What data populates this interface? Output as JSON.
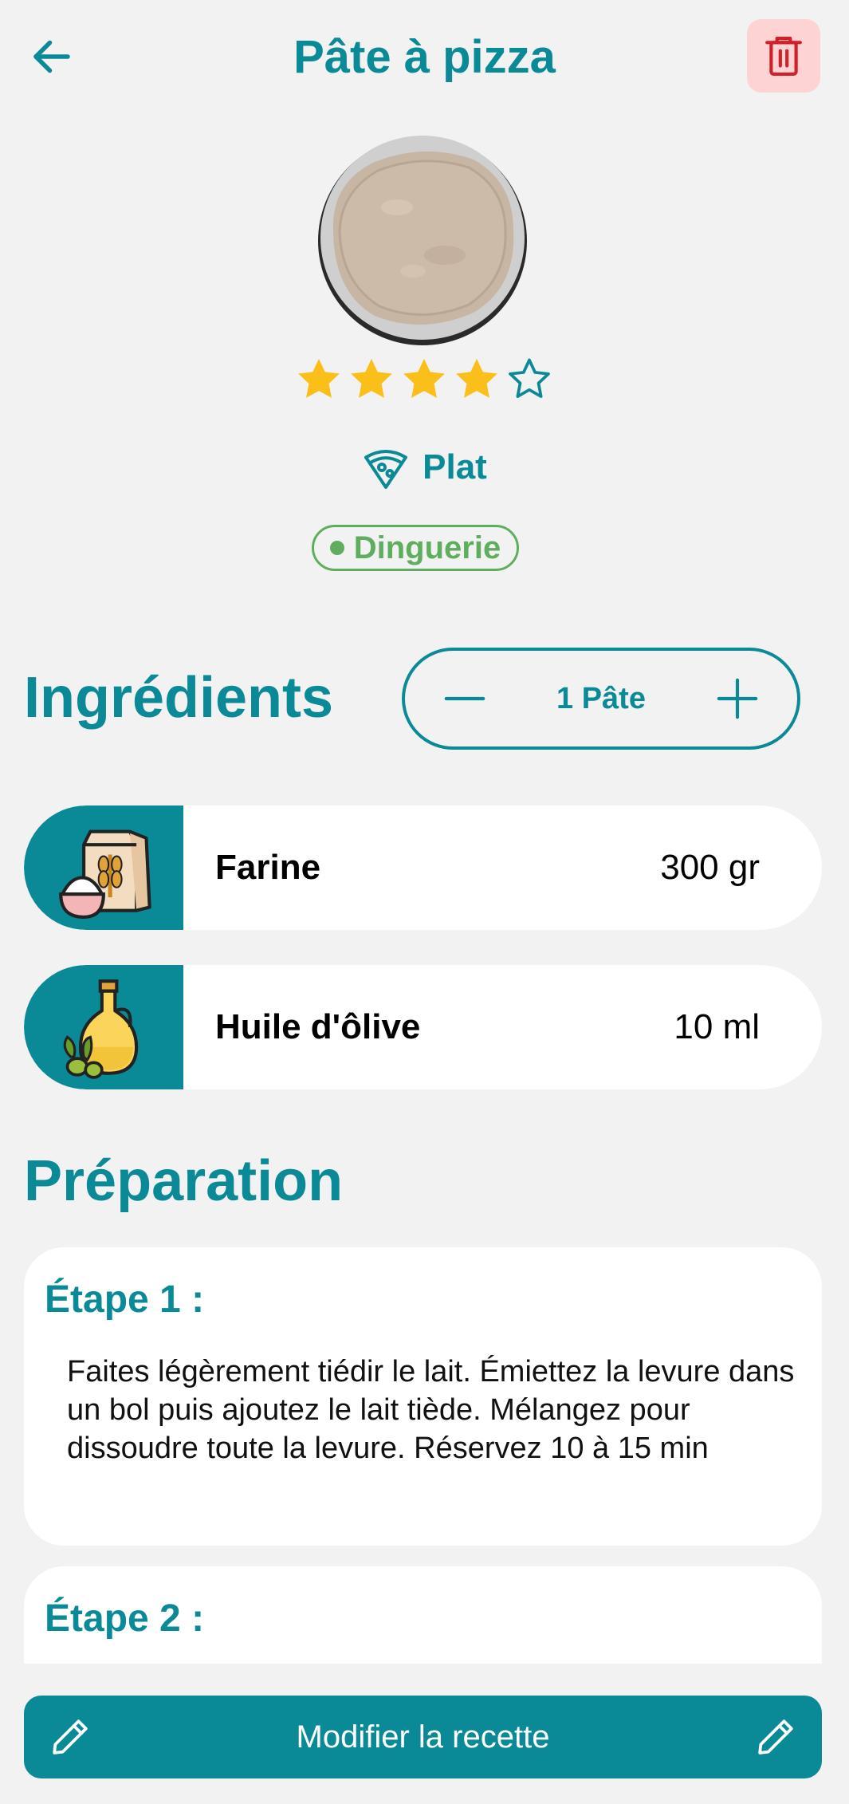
{
  "header": {
    "title": "Pâte à pizza",
    "back_icon": "arrow-left-icon",
    "delete_icon": "trash-icon"
  },
  "recipe": {
    "rating": 4,
    "rating_max": 5,
    "category": "Plat",
    "category_icon": "pizza-slice-icon",
    "tag": "Dinguerie"
  },
  "ingredients_section": {
    "title": "Ingrédients",
    "servings_label": "1 Pâte",
    "items": [
      {
        "name": "Farine",
        "quantity": "300 gr",
        "icon": "flour-bag-icon"
      },
      {
        "name": "Huile d'ôlive",
        "quantity": "10 ml",
        "icon": "olive-oil-icon"
      }
    ]
  },
  "preparation_section": {
    "title": "Préparation",
    "steps": [
      {
        "title": "Étape 1 :",
        "text": "Faites légèrement tiédir le lait. Émiettez la levure dans un bol puis ajoutez le lait tiède. Mélangez pour dissoudre toute la levure. Réservez 10 à 15 min"
      },
      {
        "title": "Étape 2 :",
        "text": ""
      }
    ]
  },
  "footer": {
    "edit_label": "Modifier la recette",
    "edit_icon": "pencil-icon"
  },
  "colors": {
    "accent": "#0a8a96",
    "background": "#f2f2f2",
    "star": "#fbbf1a",
    "tag": "#5fae5f",
    "danger": "#d0202a",
    "danger_bg": "#fdd3d3"
  }
}
